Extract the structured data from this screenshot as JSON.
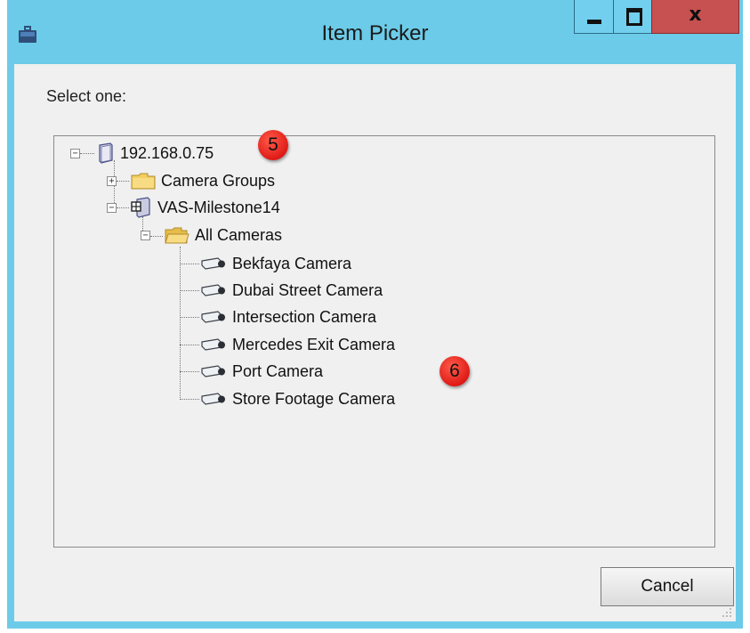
{
  "window": {
    "title": "Item Picker",
    "icons": {
      "app": "briefcase-icon",
      "minimize": "minimize-icon",
      "maximize": "maximize-icon",
      "close": "close-icon"
    },
    "close_glyph": "x"
  },
  "dialog": {
    "prompt": "Select one:",
    "cancel_label": "Cancel"
  },
  "tree": {
    "root": {
      "label": "192.168.0.75",
      "icon": "server-icon",
      "expanded": true
    },
    "camera_groups": {
      "label": "Camera Groups",
      "icon": "folder-icon",
      "expanded": false
    },
    "recording_server": {
      "label": "VAS-Milestone14",
      "icon": "recording-server-icon",
      "expanded": true
    },
    "all_cameras": {
      "label": "All Cameras",
      "icon": "open-folder-icon",
      "expanded": true
    },
    "cameras": [
      {
        "label": "Bekfaya Camera",
        "icon": "camera-icon"
      },
      {
        "label": "Dubai Street Camera",
        "icon": "camera-icon"
      },
      {
        "label": "Intersection Camera",
        "icon": "camera-icon"
      },
      {
        "label": "Mercedes Exit Camera",
        "icon": "camera-icon"
      },
      {
        "label": "Port Camera",
        "icon": "camera-icon"
      },
      {
        "label": "Store Footage Camera",
        "icon": "camera-icon"
      }
    ],
    "expander": {
      "collapse": "−",
      "expand": "+"
    }
  },
  "annotations": [
    {
      "label": "5"
    },
    {
      "label": "6"
    }
  ],
  "colors": {
    "titlebar": "#6ccbe8",
    "close_button": "#c75050",
    "client": "#f0f0f0",
    "badge": "#e00000"
  }
}
